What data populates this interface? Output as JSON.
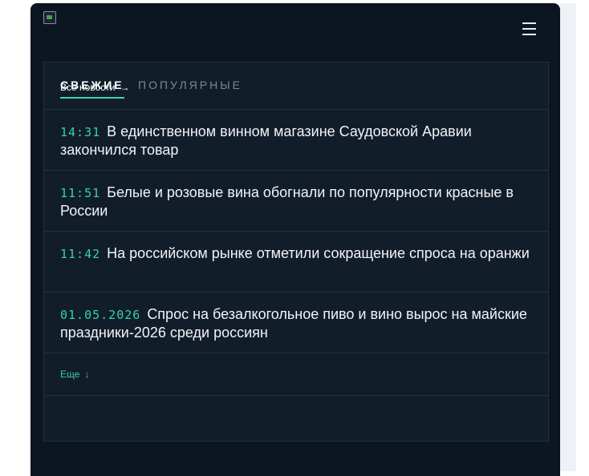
{
  "tabs": {
    "fresh": "СВЕЖИЕ",
    "popular": "ПОПУЛЯРНЫЕ"
  },
  "news": [
    {
      "time": "14:31",
      "title": "В единственном винном магазине Саудовской Аравии закончился товар"
    },
    {
      "time": "11:51",
      "title": "Белые и розовые вина обогнали по популярности красные в России"
    },
    {
      "time": "11:42",
      "title": "На российском рынке отметили сокращение спроса на оранжи"
    },
    {
      "time": "01.05.2026",
      "title": "Спрос на безалкогольное пиво и вино вырос на майские праздники-2026 среди россиян"
    }
  ],
  "more": {
    "label": "Еще",
    "icon": "↓"
  },
  "all_news": {
    "label": "Все новости",
    "icon": "→"
  },
  "colors": {
    "accent": "#36d39f",
    "panel": "#0c1622",
    "box": "#121d2a"
  }
}
